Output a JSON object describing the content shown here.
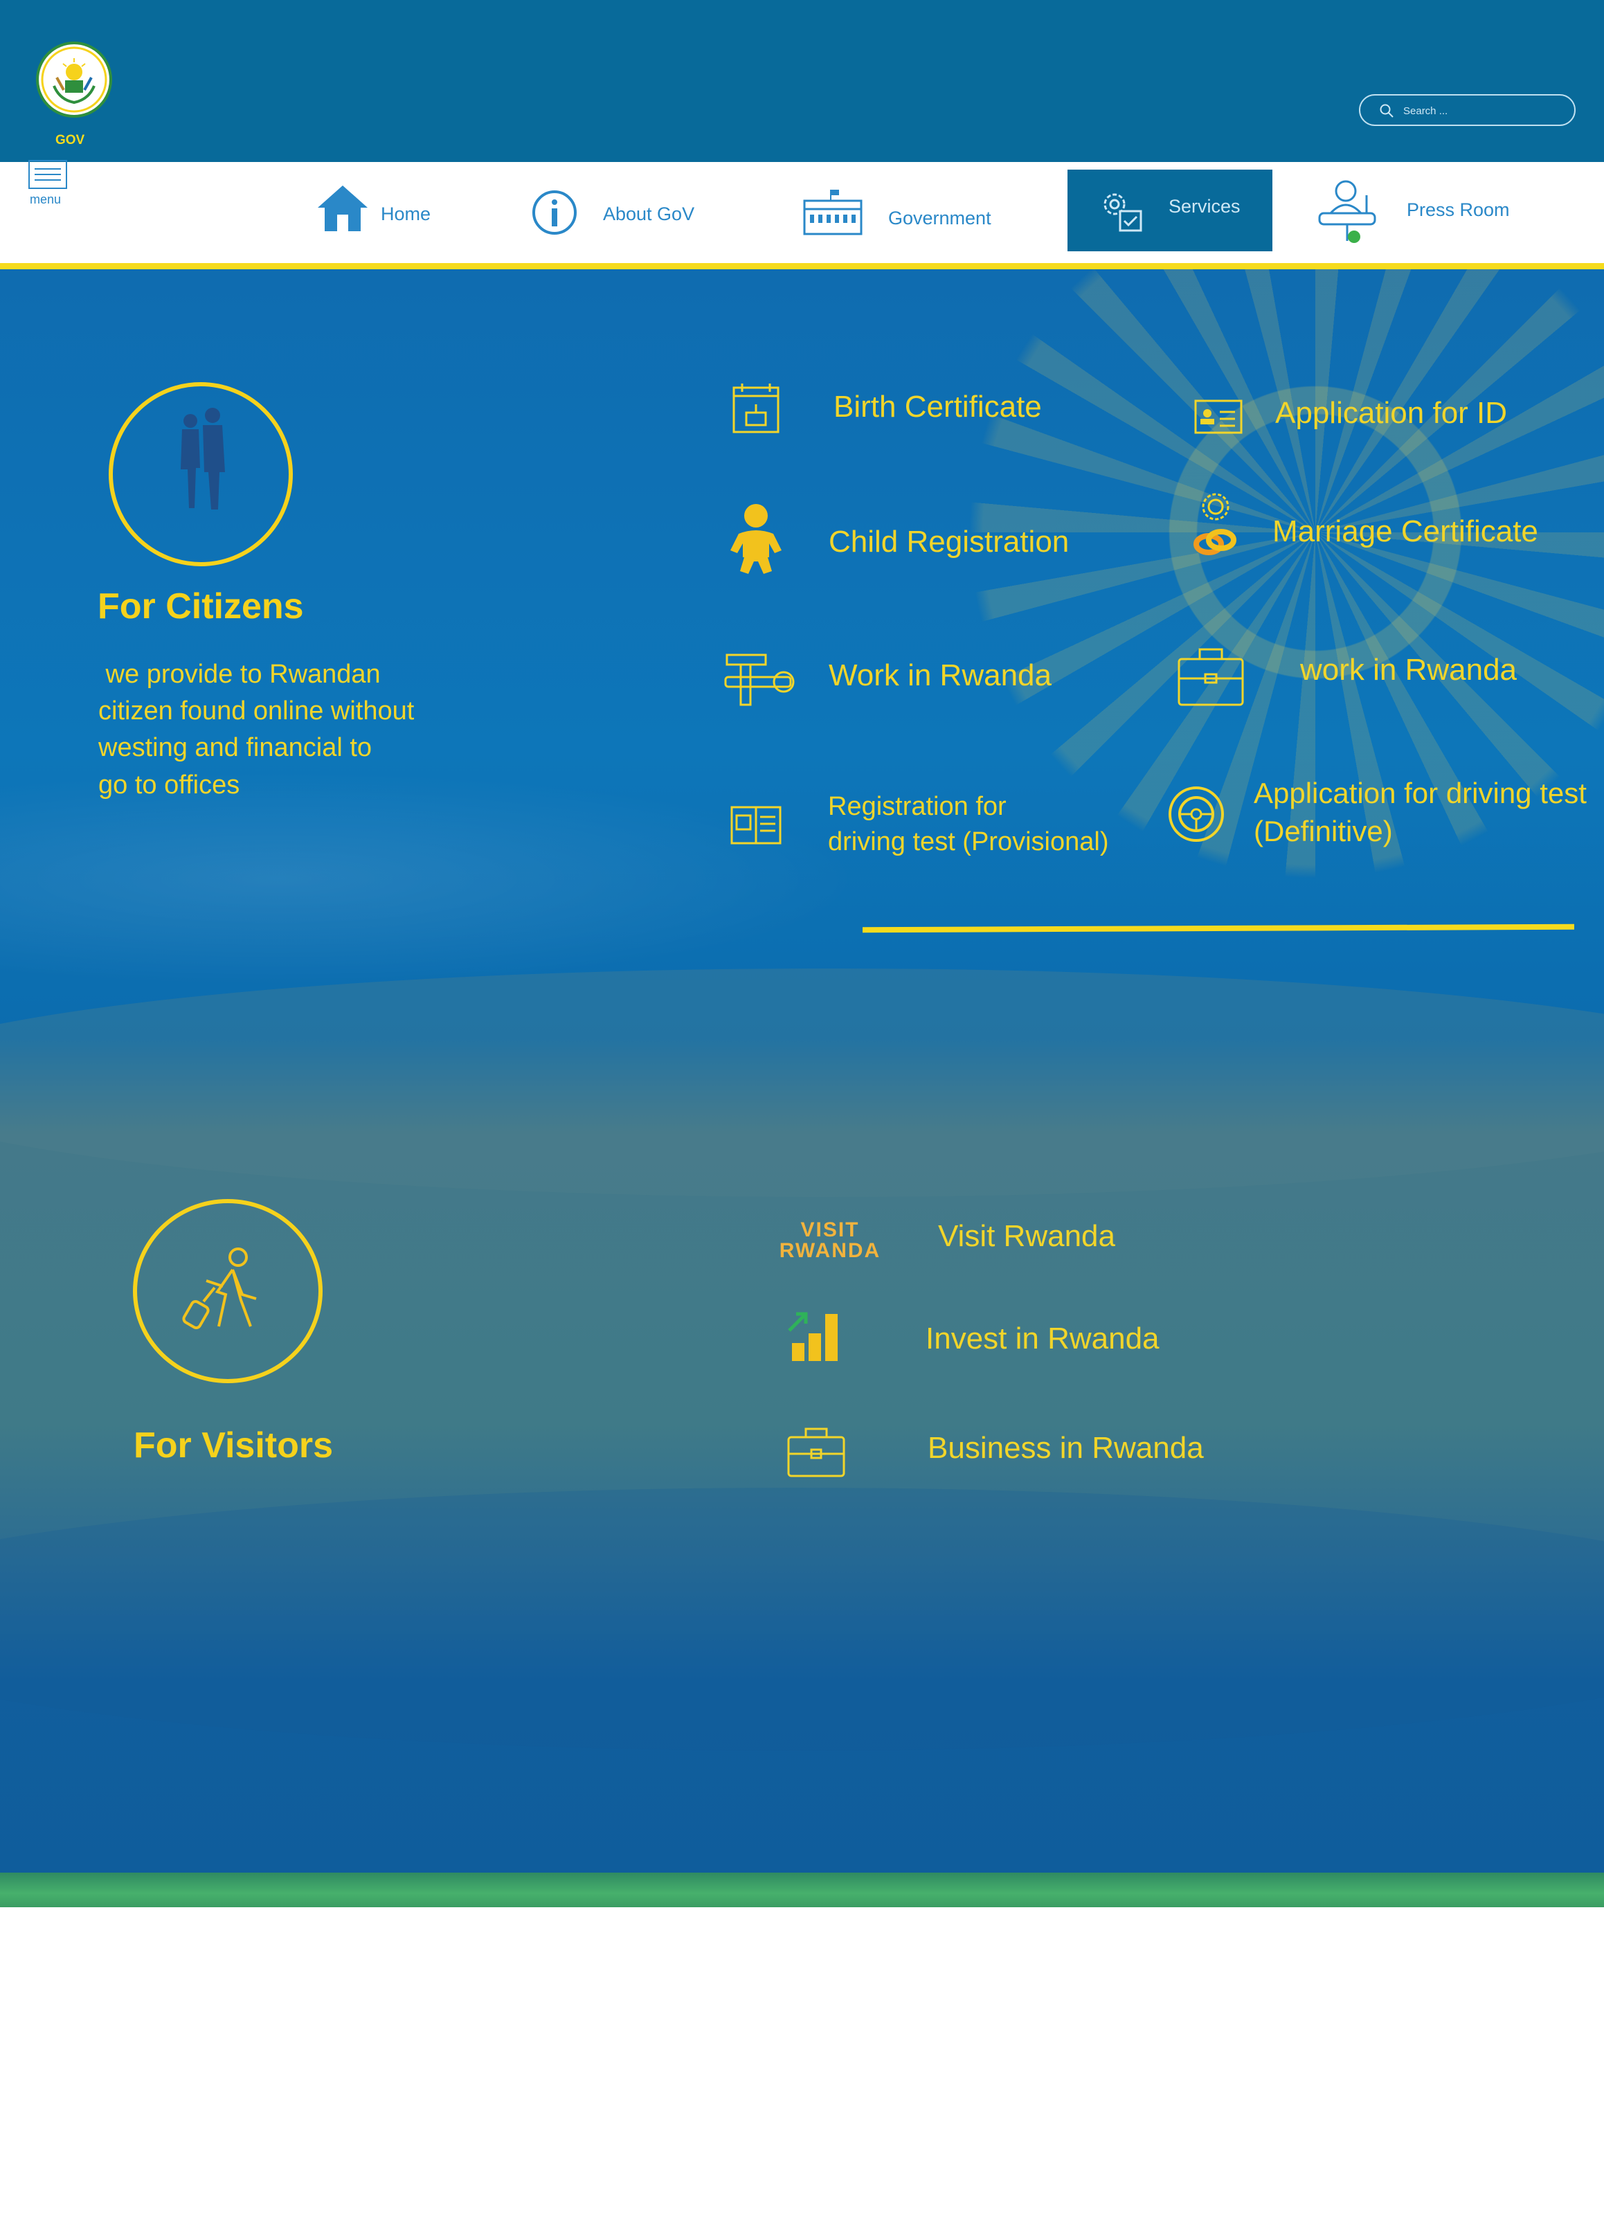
{
  "header": {
    "logo_label": "GOV",
    "search_placeholder": "Search ..."
  },
  "menu": {
    "label": "menu"
  },
  "nav": {
    "items": [
      {
        "label": "Home",
        "icon": "home-icon"
      },
      {
        "label": "About GoV",
        "icon": "info-icon"
      },
      {
        "label": "Government",
        "icon": "building-icon"
      },
      {
        "label": "Services",
        "icon": "gear-checklist-icon",
        "active": true
      },
      {
        "label": "Press Room",
        "icon": "speaker-podium-icon"
      }
    ]
  },
  "citizens": {
    "heading": "For Citizens",
    "description": [
      " we provide to Rwandan",
      "citizen found online without",
      "westing and financial to",
      "go to offices"
    ],
    "services": [
      {
        "label": "Birth Certificate",
        "icon": "calendar-cake-icon"
      },
      {
        "label": "Application for ID",
        "icon": "id-card-icon"
      },
      {
        "label": "Child Registration",
        "icon": "baby-icon"
      },
      {
        "label": "Marriage Certificate",
        "icon": "rings-icon"
      },
      {
        "label": "Work in Rwanda",
        "icon": "tools-icon"
      },
      {
        "label": "work in Rwanda",
        "icon": "briefcase-icon"
      },
      {
        "label_lines": [
          "Registration for",
          "driving test (Provisional)"
        ],
        "icon": "license-book-icon"
      },
      {
        "label_lines": [
          "Application for driving test",
          "(Definitive)"
        ],
        "icon": "steering-wheel-icon"
      }
    ]
  },
  "visitors": {
    "heading": "For Visitors",
    "services": [
      {
        "label": "Visit Rwanda",
        "logo_lines": [
          "VISIT",
          "RWANDA"
        ]
      },
      {
        "label": "Invest in Rwanda",
        "icon": "growth-chart-icon"
      },
      {
        "label": "Business in Rwanda",
        "icon": "briefcase-icon"
      }
    ]
  },
  "colors": {
    "header_bg": "#086a9a",
    "accent_yellow": "#f6d21c",
    "nav_text": "#2a88c8",
    "hero_blue": "#0f6cb0",
    "hero_teal": "#44798a",
    "green_strip": "#47b06c"
  }
}
